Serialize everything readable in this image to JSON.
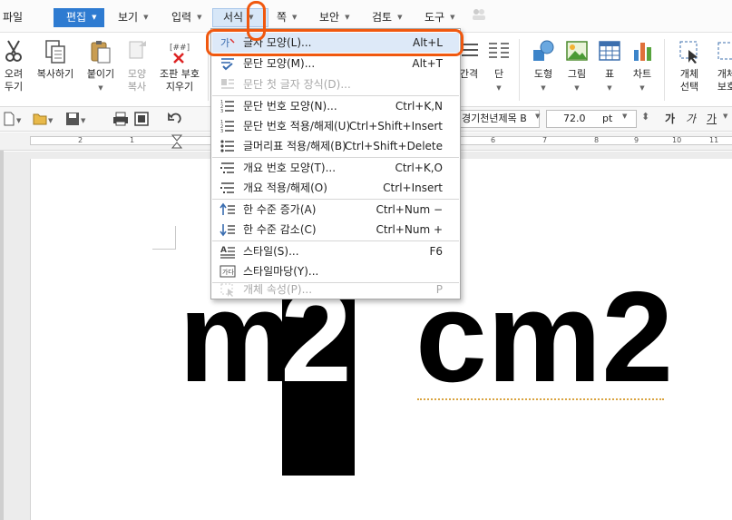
{
  "menubar": {
    "file": "파일",
    "edit": "편집",
    "view": "보기",
    "insert": "입력",
    "format": "서식",
    "page": "쪽",
    "security": "보안",
    "review": "검토",
    "tools": "도구"
  },
  "ribbon": {
    "cut_line1": "오려",
    "cut_line2": "두기",
    "copy": "복사하기",
    "paste": "붙이기",
    "format_copy_line1": "모양",
    "format_copy_line2": "복사",
    "erase_line1": "조판 부호",
    "erase_line2": "지우기",
    "spacing": "간격",
    "column": "단",
    "shape": "도형",
    "picture": "그림",
    "table": "표",
    "chart": "차트",
    "select_line1": "개체",
    "select_line2": "선택",
    "protect_line1": "개체",
    "protect_line2": "보호"
  },
  "toolbar": {
    "font_name": "경기천년제목 B",
    "font_size": "72.0",
    "size_unit": "pt",
    "style_btn1": "가",
    "style_btn2": "가",
    "style_btn3": "가"
  },
  "ruler": {
    "ticks": [
      "2",
      "1",
      "1",
      "2",
      "3",
      "4",
      "5",
      "6",
      "7",
      "8",
      "9",
      "10",
      "11"
    ]
  },
  "document": {
    "m": "m",
    "two": "2",
    "cm2": "cm2"
  },
  "dropdown": {
    "items": [
      {
        "label": "글자 모양(L)...",
        "shortcut": "Alt+L"
      },
      {
        "label": "문단 모양(M)...",
        "shortcut": "Alt+T"
      },
      {
        "label": "문단 첫 글자 장식(D)...",
        "shortcut": ""
      },
      {
        "label": "문단 번호 모양(N)...",
        "shortcut": "Ctrl+K,N"
      },
      {
        "label": "문단 번호 적용/해제(U)",
        "shortcut": "Ctrl+Shift+Insert"
      },
      {
        "label": "글머리표 적용/해제(B)",
        "shortcut": "Ctrl+Shift+Delete"
      },
      {
        "label": "개요 번호 모양(T)...",
        "shortcut": "Ctrl+K,O"
      },
      {
        "label": "개요 적용/해제(O)",
        "shortcut": "Ctrl+Insert"
      },
      {
        "label": "한 수준 증가(A)",
        "shortcut": "Ctrl+Num −"
      },
      {
        "label": "한 수준 감소(C)",
        "shortcut": "Ctrl+Num +"
      },
      {
        "label": "스타일(S)...",
        "shortcut": "F6"
      },
      {
        "label": "스타일마당(Y)...",
        "shortcut": ""
      },
      {
        "label": "개체 속성(P)...",
        "shortcut": "P"
      }
    ]
  },
  "colors": {
    "annotation": "#f0580f",
    "edit_menu_bg": "#2e7bd1",
    "format_menu_bg": "#d7e7f8",
    "highlight": "#dde9f8"
  }
}
